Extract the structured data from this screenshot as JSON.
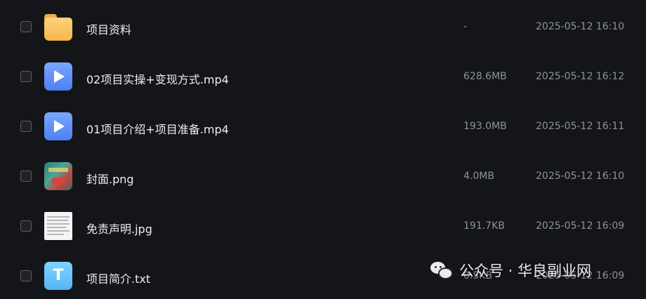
{
  "files": [
    {
      "name": "项目资料",
      "size": "-",
      "date": "2025-05-12 16:10",
      "icon": "folder-icon"
    },
    {
      "name": "02项目实操+变现方式.mp4",
      "size": "628.6MB",
      "date": "2025-05-12 16:12",
      "icon": "video-icon"
    },
    {
      "name": "01项目介绍+项目准备.mp4",
      "size": "193.0MB",
      "date": "2025-05-12 16:11",
      "icon": "video-icon"
    },
    {
      "name": "封面.png",
      "size": "4.0MB",
      "date": "2025-05-12 16:10",
      "icon": "image-thumbnail"
    },
    {
      "name": "免责声明.jpg",
      "size": "191.7KB",
      "date": "2025-05-12 16:09",
      "icon": "document-thumbnail"
    },
    {
      "name": "项目简介.txt",
      "size": "0.5KB",
      "date": "2025-05-12 16:09",
      "icon": "txt-icon"
    }
  ],
  "icon_text": {
    "txt": "T"
  },
  "watermark": {
    "text": "公众号 · 华良副业网"
  },
  "colors": {
    "background": "#141518",
    "folder": "#f6b54b",
    "video": "#5a8cf5",
    "txt": "#62bff8",
    "secondary_text": "#8e929a"
  }
}
